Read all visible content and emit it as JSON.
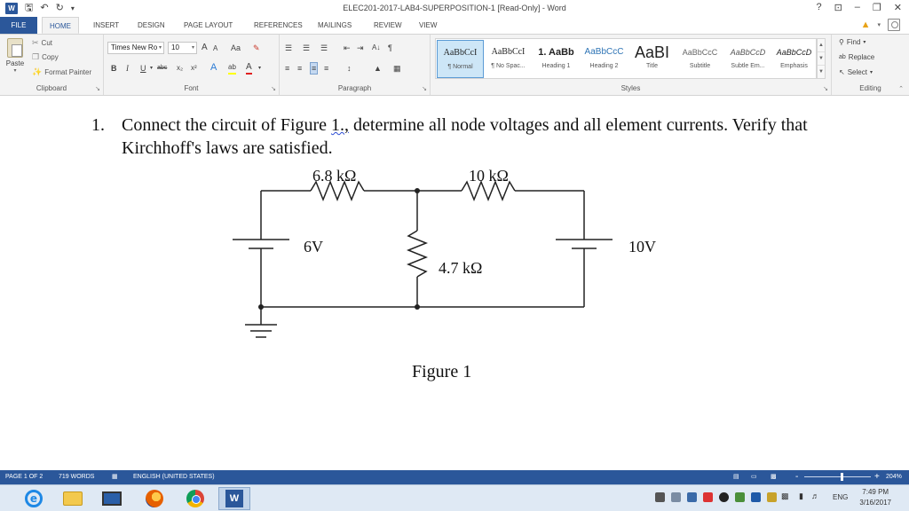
{
  "titlebar": {
    "title": "ELEC201-2017-LAB4-SUPERPOSITION-1 [Read-Only] - Word",
    "app_logo": "W",
    "qat": [
      "save-icon",
      "undo-icon",
      "redo-icon",
      "customize-icon"
    ],
    "controls": {
      "help": "?",
      "ribbon_display": "⊡",
      "minimize": "–",
      "restore": "❐",
      "close": "✕"
    }
  },
  "tabs": [
    {
      "label": "FILE"
    },
    {
      "label": "HOME",
      "active": true
    },
    {
      "label": "INSERT"
    },
    {
      "label": "DESIGN"
    },
    {
      "label": "PAGE LAYOUT"
    },
    {
      "label": "REFERENCES"
    },
    {
      "label": "MAILINGS"
    },
    {
      "label": "REVIEW"
    },
    {
      "label": "VIEW"
    }
  ],
  "ribbon": {
    "clipboard": {
      "label": "Clipboard",
      "paste": "Paste",
      "cut": "Cut",
      "copy": "Copy",
      "format_painter": "Format Painter"
    },
    "font": {
      "label": "Font",
      "font_name": "Times New Ro",
      "font_size": "10",
      "grow": "A",
      "shrink": "A",
      "case": "Aa",
      "bold": "B",
      "italic": "I",
      "underline": "U",
      "strike": "abc",
      "subscript": "x₂",
      "superscript": "x²",
      "text_effects": "A",
      "highlight": "ab",
      "font_color": "A"
    },
    "paragraph": {
      "label": "Paragraph",
      "show_marks": "¶",
      "sort": "A↓"
    },
    "styles": {
      "label": "Styles",
      "items": [
        {
          "sample": "AaBbCcI",
          "name": "¶ Normal",
          "selected": true
        },
        {
          "sample": "AaBbCcI",
          "name": "¶ No Spac..."
        },
        {
          "sample": "1. AaBb",
          "name": "Heading 1"
        },
        {
          "sample": "AaBbCcC",
          "name": "Heading 2"
        },
        {
          "sample": "AaBI",
          "name": "Title"
        },
        {
          "sample": "AaBbCcC",
          "name": "Subtitle"
        },
        {
          "sample": "AaBbCcD",
          "name": "Subtle Em..."
        },
        {
          "sample": "AaBbCcD",
          "name": "Emphasis"
        }
      ]
    },
    "editing": {
      "label": "Editing",
      "find": "Find",
      "replace": "Replace",
      "select": "Select"
    }
  },
  "document": {
    "question_number": "1.",
    "question_part1": "Connect the circuit of Figure ",
    "question_fig_ref": "1.,",
    "question_part2": " determine all node voltages and all element currents. Verify that Kirchhoff's laws are satisfied.",
    "circuit": {
      "r1_value": "6.8 k",
      "r2_value": "10 k",
      "r3_value": "4.7 k",
      "unit_symbol": "Ω",
      "source1": "6V",
      "source2": "10V"
    },
    "figure_caption": "Figure 1"
  },
  "statusbar": {
    "page": "PAGE 1 OF 2",
    "words": "719 WORDS",
    "language": "ENGLISH (UNITED STATES)",
    "zoom_minus": "-",
    "zoom_plus": "+",
    "zoom": "204%"
  },
  "taskbar": {
    "apps": [
      "internet-explorer",
      "file-explorer",
      "remote-desktop",
      "firefox",
      "chrome",
      "word"
    ],
    "language": "ENG",
    "time": "7:49 PM",
    "date": "3/16/2017"
  },
  "colors": {
    "accent": "#2b579a",
    "ribbon_bg": "#f3f3f3",
    "taskbar_bg": "#dfe9f4"
  }
}
